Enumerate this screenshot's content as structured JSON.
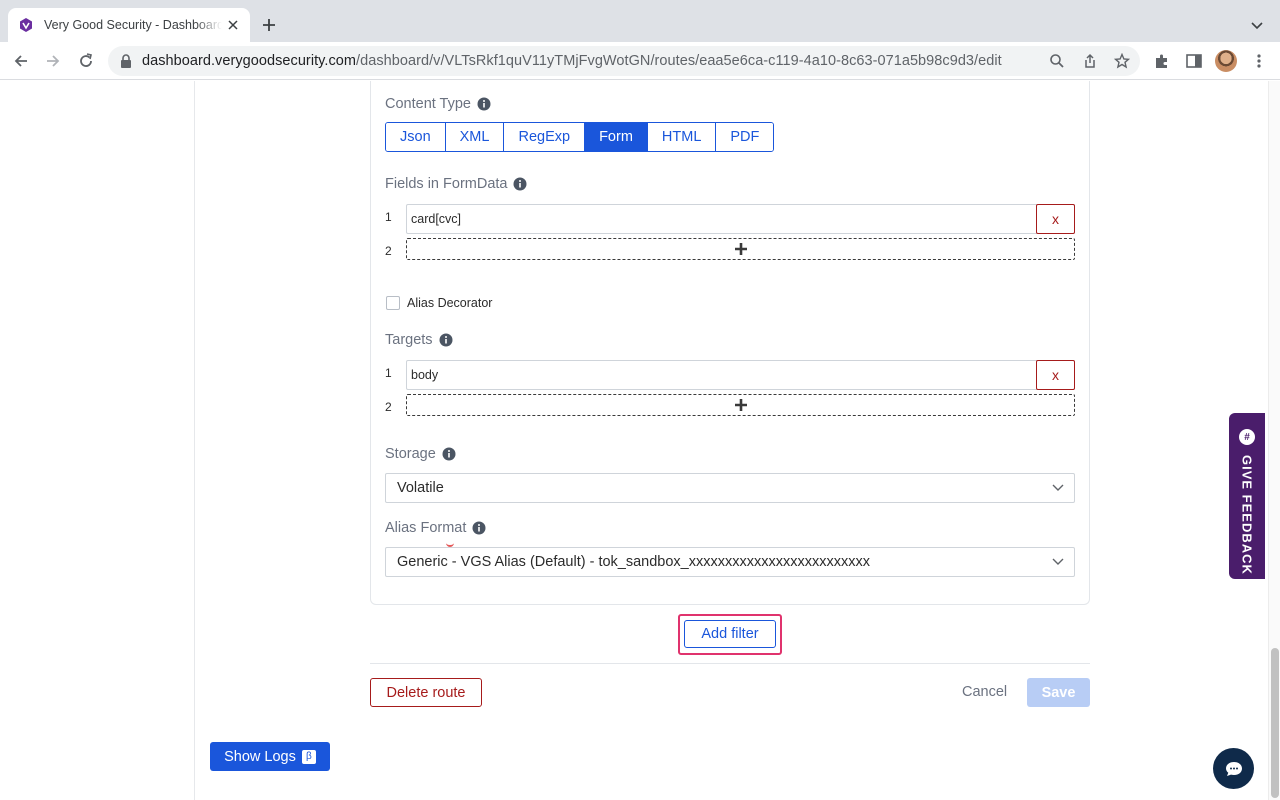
{
  "browser": {
    "tab_title": "Very Good Security - Dashboard",
    "url_host": "dashboard.verygoodsecurity.com",
    "url_path": "/dashboard/v/VLTsRkf1quV11yTMjFvgWotGN/routes/eaa5e6ca-c119-4a10-8c63-071a5b98c9d3/edit"
  },
  "filter": {
    "content_type_label": "Content Type",
    "content_types": [
      "Json",
      "XML",
      "RegExp",
      "Form",
      "HTML",
      "PDF"
    ],
    "selected_content_type": "Form",
    "fields_label": "Fields in FormData",
    "fields": [
      {
        "num": "1",
        "value": "card[cvc]",
        "remove": "x"
      }
    ],
    "fields_add_num": "2",
    "alias_decorator_label": "Alias Decorator",
    "targets_label": "Targets",
    "targets": [
      {
        "num": "1",
        "value": "body",
        "remove": "x"
      }
    ],
    "targets_add_num": "2",
    "storage_label": "Storage",
    "storage_value": "Volatile",
    "alias_format_label": "Alias Format",
    "alias_format_value": "Generic - VGS Alias (Default) - tok_sandbox_xxxxxxxxxxxxxxxxxxxxxxxxx"
  },
  "actions": {
    "add_filter": "Add filter",
    "delete_route": "Delete route",
    "cancel": "Cancel",
    "save": "Save",
    "show_logs": "Show Logs",
    "beta": "β"
  },
  "feedback": {
    "label": "GIVE FEEDBACK"
  },
  "colors": {
    "primary": "#1a56db",
    "danger": "#a61b1b",
    "highlight": "#e0336d",
    "feedback_bg": "#4a1d6b"
  }
}
